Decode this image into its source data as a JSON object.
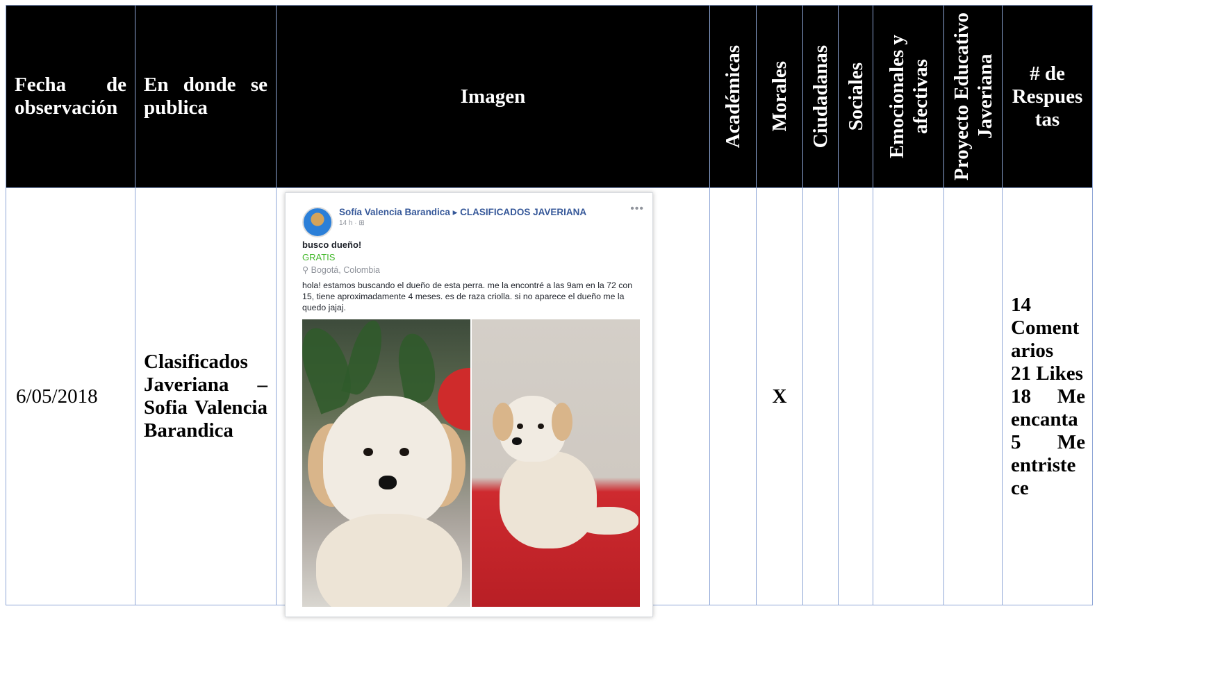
{
  "table": {
    "headers": {
      "fecha": [
        "Fecha",
        "de",
        "observación"
      ],
      "donde": [
        "En",
        "donde",
        "se",
        "publica"
      ],
      "imagen": "Imagen",
      "academicas": "Académicas",
      "morales": "Morales",
      "ciudadanas": "Ciudadanas",
      "sociales": "Sociales",
      "emocionales": [
        "Emocionales y",
        "afectivas"
      ],
      "proyecto": [
        "Proyecto Educativo",
        "Javeriana"
      ],
      "respuestas": [
        "# de",
        "Respues",
        "tas"
      ]
    },
    "row": {
      "fecha": "6/05/2018",
      "donde": [
        "Clasificados",
        "Javeriana –",
        "Sofia Valencia",
        "Barandica"
      ],
      "morales_mark": "X",
      "respuestas": [
        "14",
        "Coment",
        "arios",
        "21 Likes",
        "18 Me",
        "encanta",
        "5 Me",
        "entriste",
        "ce"
      ]
    }
  },
  "post": {
    "author": "Sofía Valencia Barandica ▸ CLASIFICADOS JAVERIANA",
    "time": "14 h · ⊞",
    "more": "•••",
    "title": "busco dueño!",
    "price": "GRATIS",
    "location": "⚲ Bogotá, Colombia",
    "text": "hola! estamos buscando el dueño de esta perra. me la encontré a las 9am en la 72 con 15, tiene aproximadamente 4 meses. es de raza criolla. si no aparece el dueño me la quedo jajaj."
  },
  "colors": {
    "header_bg": "#000000",
    "grid": "#8ea6d6",
    "fb_link": "#365899",
    "fb_price": "#42b72a"
  }
}
